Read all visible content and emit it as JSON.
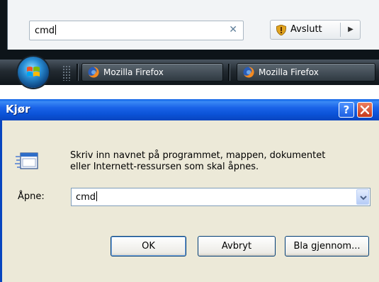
{
  "start_menu": {
    "search_value": "cmd",
    "shutdown_label": "Avslutt"
  },
  "taskbar": {
    "items": [
      {
        "label": "Mozilla Firefox"
      },
      {
        "label": "Mozilla Firefox"
      }
    ]
  },
  "run_dialog": {
    "title": "Kjør",
    "description_line_1": "Skriv inn navnet på programmet, mappen, dokumentet",
    "description_line_2": "eller Internett-ressursen som skal åpnes.",
    "open_label": "Åpne:",
    "open_value": "cmd",
    "buttons": {
      "ok": "OK",
      "cancel": "Avbryt",
      "browse": "Bla gjennom..."
    }
  },
  "colors": {
    "xp_title_blue": "#0b53d8",
    "dialog_face": "#ece9d8",
    "close_red": "#c5381c",
    "taskbar_dark": "#222a31"
  },
  "icons": {
    "search_clear": "close-icon",
    "shutdown": "shield-icon",
    "start": "windows-orb-icon",
    "task": "firefox-icon",
    "help": "help-icon",
    "close": "close-icon",
    "run": "run-program-icon",
    "dropdown": "chevron-down-icon"
  }
}
